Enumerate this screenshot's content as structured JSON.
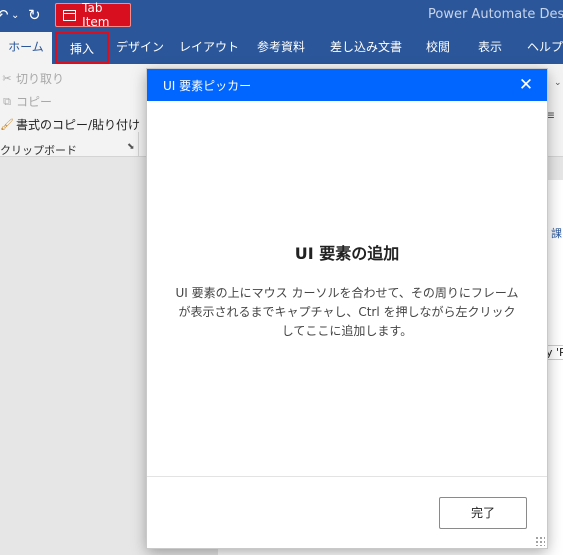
{
  "titlebar": {
    "app_title": "Power Automate Deskt",
    "undo_icon": "undo-icon",
    "redo_icon": "redo-icon",
    "tab_item_badge": "Tab Item"
  },
  "ribbon": {
    "tabs": [
      {
        "label": "ホーム"
      },
      {
        "label": "挿入"
      },
      {
        "label": "デザイン"
      },
      {
        "label": "レイアウト"
      },
      {
        "label": "参考資料"
      },
      {
        "label": "差し込み文書"
      },
      {
        "label": "校閲"
      },
      {
        "label": "表示"
      },
      {
        "label": "ヘルプ"
      }
    ],
    "clipboard": {
      "cut": "切り取り",
      "copy": "コピー",
      "format_painter": "書式のコピー/貼り付け",
      "group_label": "クリップボード"
    }
  },
  "side_fragments": {
    "right_a": "課",
    "right_b": "y 'Po"
  },
  "dialog": {
    "title": "UI 要素ピッカー",
    "heading": "UI 要素の追加",
    "description": "UI 要素の上にマウス カーソルを合わせて、その周りにフレームが表示されるまでキャプチャし、Ctrl を押しながら左クリックしてここに追加します。",
    "done_label": "完了"
  },
  "colors": {
    "ribbon_blue": "#2b579a",
    "dialog_header": "#0066ff",
    "highlight_red": "#d70f1f"
  }
}
